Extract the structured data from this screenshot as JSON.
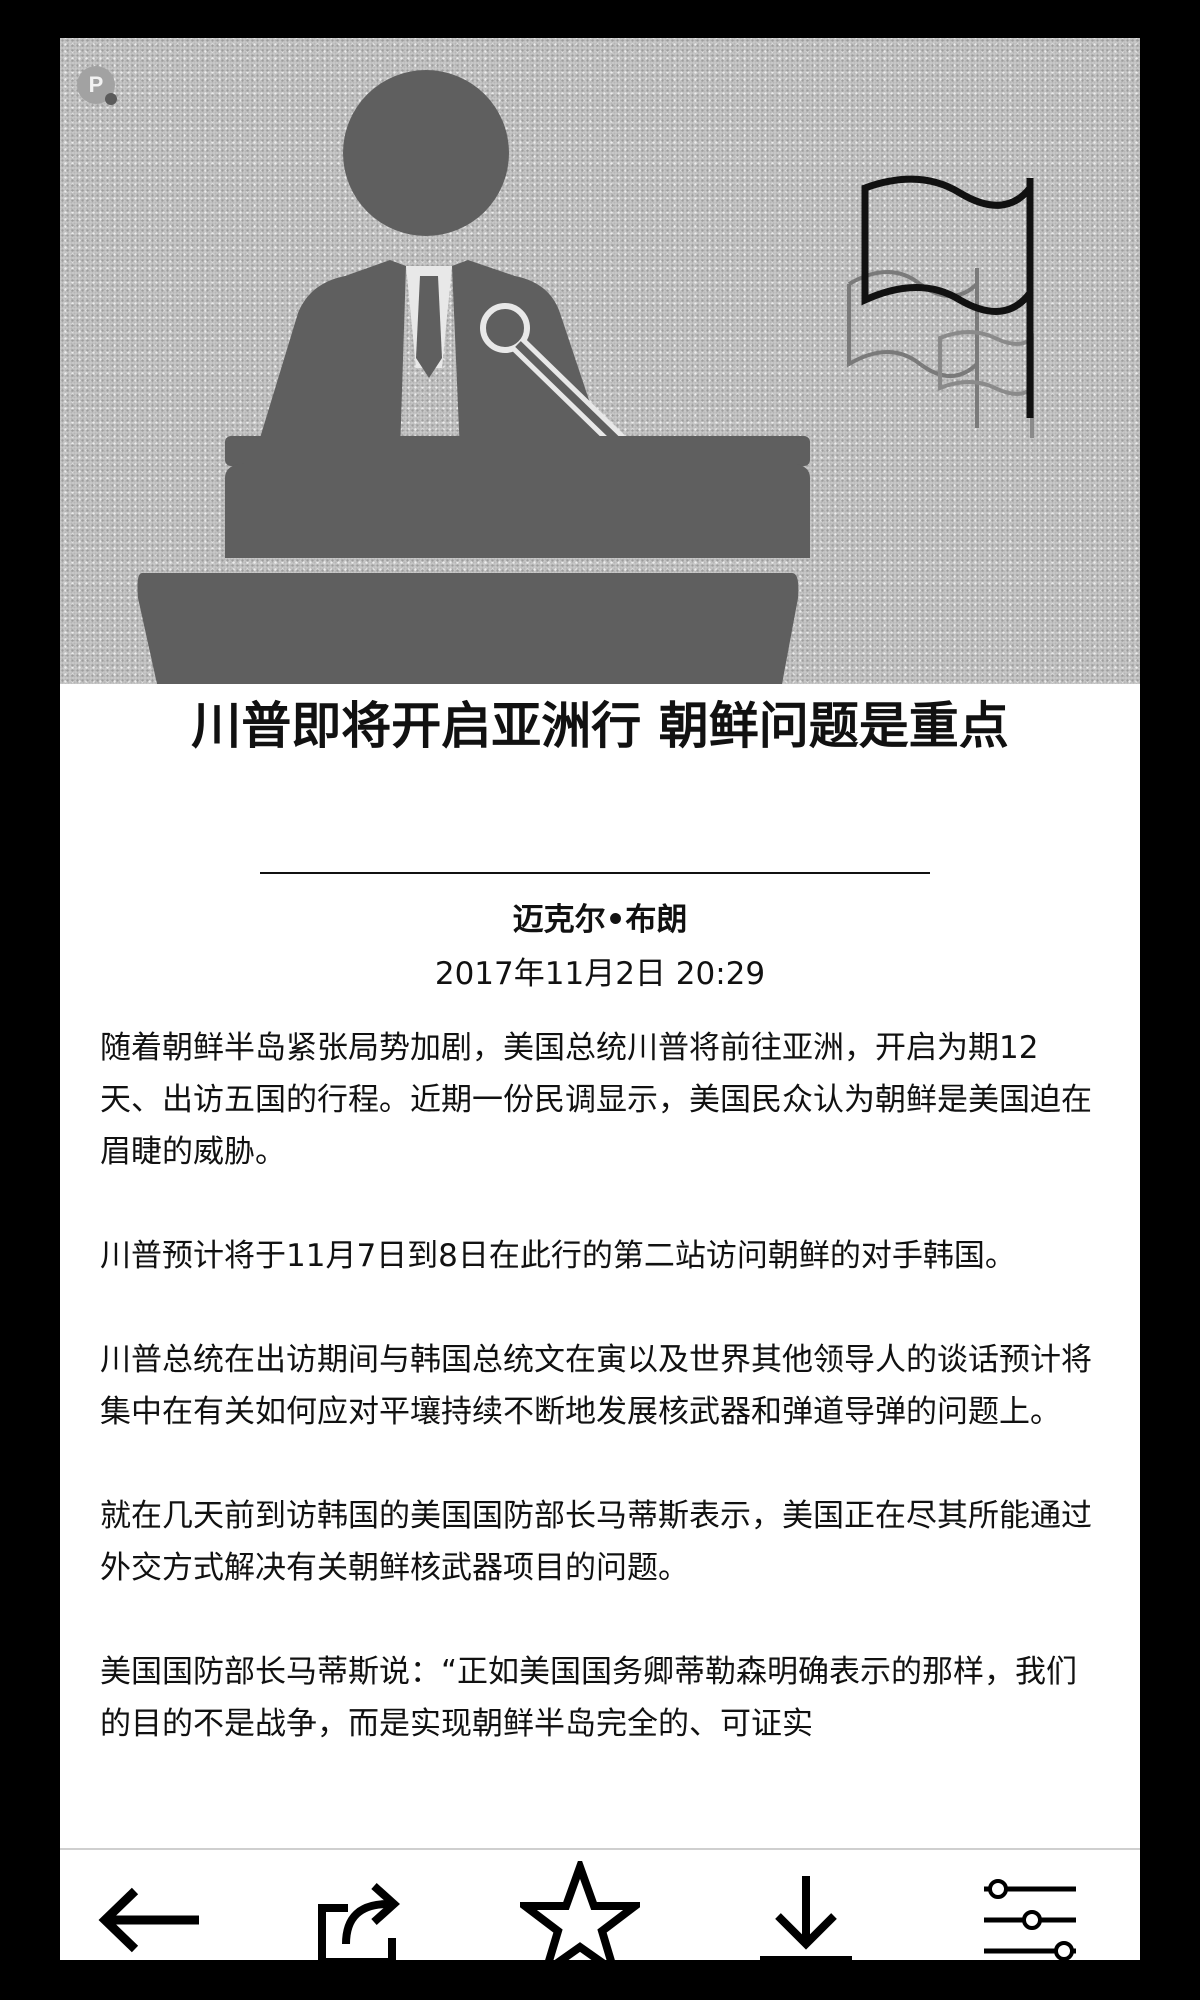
{
  "hero": {
    "badge_letter": "P"
  },
  "article": {
    "title": "川普即将开启亚洲行 朝鲜问题是重点",
    "author": "迈克尔•布朗",
    "datetime": "2017年11月2日  20:29",
    "paragraphs": [
      "随着朝鲜半岛紧张局势加剧，美国总统川普将前往亚洲，开启为期12天、出访五国的行程。近期一份民调显示，美国民众认为朝鲜是美国迫在眉睫的威胁。",
      "川普预计将于11月7日到8日在此行的第二站访问朝鲜的对手韩国。",
      "川普总统在出访期间与韩国总统文在寅以及世界其他领导人的谈话预计将集中在有关如何应对平壤持续不断地发展核武器和弹道导弹的问题上。",
      "就在几天前到访韩国的美国国防部长马蒂斯表示，美国正在尽其所能通过外交方式解决有关朝鲜核武器项目的问题。",
      "美国国防部长马蒂斯说：“正如美国国务卿蒂勒森明确表示的那样，我们的目的不是战争，而是实现朝鲜半岛完全的、可证实"
    ]
  },
  "toolbar": {
    "buttons": [
      {
        "name": "back",
        "icon": "arrow-left-icon"
      },
      {
        "name": "share",
        "icon": "share-icon"
      },
      {
        "name": "favorite",
        "icon": "star-icon"
      },
      {
        "name": "download",
        "icon": "download-icon"
      },
      {
        "name": "settings",
        "icon": "sliders-icon"
      }
    ]
  },
  "colors": {
    "frame": "#000000",
    "text": "#111111",
    "hero_bg": "#c9c9c9",
    "hero_figure": "#5f5f5f"
  }
}
